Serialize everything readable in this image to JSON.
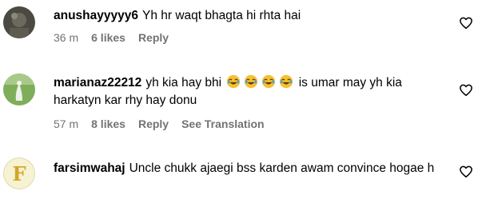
{
  "comments": [
    {
      "username": "anushayyyyy6",
      "text": "Yh hr waqt bhagta hi rhta hai",
      "time": "36 m",
      "likes": "6 likes",
      "reply": "Reply"
    },
    {
      "username": "marianaz22212",
      "text_before": "yh kia hay bhi",
      "emoji_name": "face-with-tears-of-joy",
      "text_after": "is umar may yh kia harkatyn kar rhy hay donu",
      "time": "57 m",
      "likes": "8 likes",
      "reply": "Reply",
      "translate": "See Translation"
    },
    {
      "username": "farsimwahaj",
      "text": "Uncle chukk ajaegi bss karden awam convince hogae h"
    }
  ],
  "icons": {
    "like": "heart-outline-icon"
  },
  "colors": {
    "meta_text": "#737373",
    "emoji_yellow": "#f7c12c"
  }
}
